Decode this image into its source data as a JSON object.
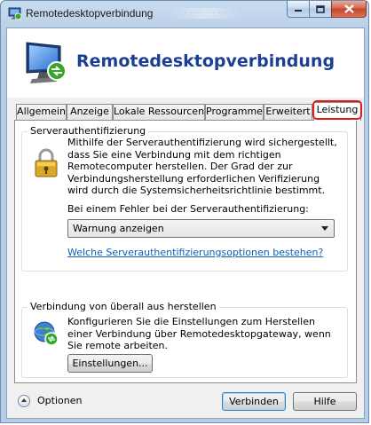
{
  "window": {
    "title": "Remotedesktopverbindung",
    "blurred_title_text": "· · · · · · · · · ·"
  },
  "banner": {
    "title": "Remotedesktopverbindung"
  },
  "tabs": [
    {
      "label": "Allgemein",
      "active": false
    },
    {
      "label": "Anzeige",
      "active": false
    },
    {
      "label": "Lokale Ressourcen",
      "active": false
    },
    {
      "label": "Programme",
      "active": false
    },
    {
      "label": "Erweitert",
      "active": false
    },
    {
      "label": "Leistung",
      "active": true
    }
  ],
  "server_auth": {
    "group_title": "Serverauthentifizierung",
    "description": "Mithilfe der Serverauthentifizierung wird sichergestellt, dass Sie eine Verbindung mit dem richtigen Remotecomputer herstellen. Der Grad der zur Verbindungsherstellung erforderlichen Verifizierung wird durch die Systemsicherheitsrichtlinie bestimmt.",
    "error_label": "Bei einem Fehler bei der Serverauthentifizierung:",
    "select_value": "Warnung anzeigen",
    "link": "Welche Serverauthentifizierungsoptionen bestehen?"
  },
  "connect_anywhere": {
    "group_title": "Verbindung von überall aus herstellen",
    "description": "Konfigurieren Sie die Einstellungen zum Herstellen einer Verbindung über Remotedesktopgateway, wenn Sie remote arbeiten.",
    "settings_button": "Einstellungen..."
  },
  "footer": {
    "options_label": "Optionen",
    "connect_button": "Verbinden",
    "help_button": "Hilfe"
  },
  "colors": {
    "banner_title": "#1c3f94",
    "link": "#0b5fb8",
    "highlight": "#e01b1b"
  }
}
